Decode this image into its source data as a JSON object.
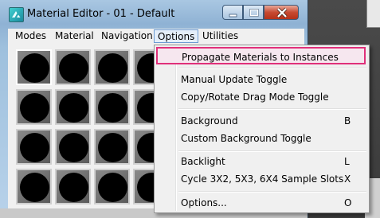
{
  "window": {
    "title": "Material Editor - 01 - Default"
  },
  "menubar": {
    "items": [
      {
        "label": "Modes"
      },
      {
        "label": "Material"
      },
      {
        "label": "Navigation"
      },
      {
        "label": "Options"
      },
      {
        "label": "Utilities"
      }
    ],
    "active_item": "Options"
  },
  "options_menu": {
    "items": [
      {
        "label": "Propagate Materials to Instances",
        "shortcut": ""
      },
      {
        "label": "Manual Update Toggle",
        "shortcut": ""
      },
      {
        "label": "Copy/Rotate Drag Mode Toggle",
        "shortcut": ""
      },
      {
        "label": "Background",
        "shortcut": "B"
      },
      {
        "label": "Custom Background Toggle",
        "shortcut": ""
      },
      {
        "label": "Backlight",
        "shortcut": "L"
      },
      {
        "label": "Cycle 3X2, 5X3, 6X4 Sample Slots",
        "shortcut": "X"
      },
      {
        "label": "Options...",
        "shortcut": "O"
      }
    ],
    "highlighted_item": "Propagate Materials to Instances",
    "highlight_color": "#e0307a"
  },
  "sample_slots": {
    "visible_count": 16,
    "selected_index": 0
  },
  "colors": {
    "title_gradient_top": "#a9c7e2",
    "close_button": "#c74a31",
    "menu_active": "#6b9bd1"
  }
}
